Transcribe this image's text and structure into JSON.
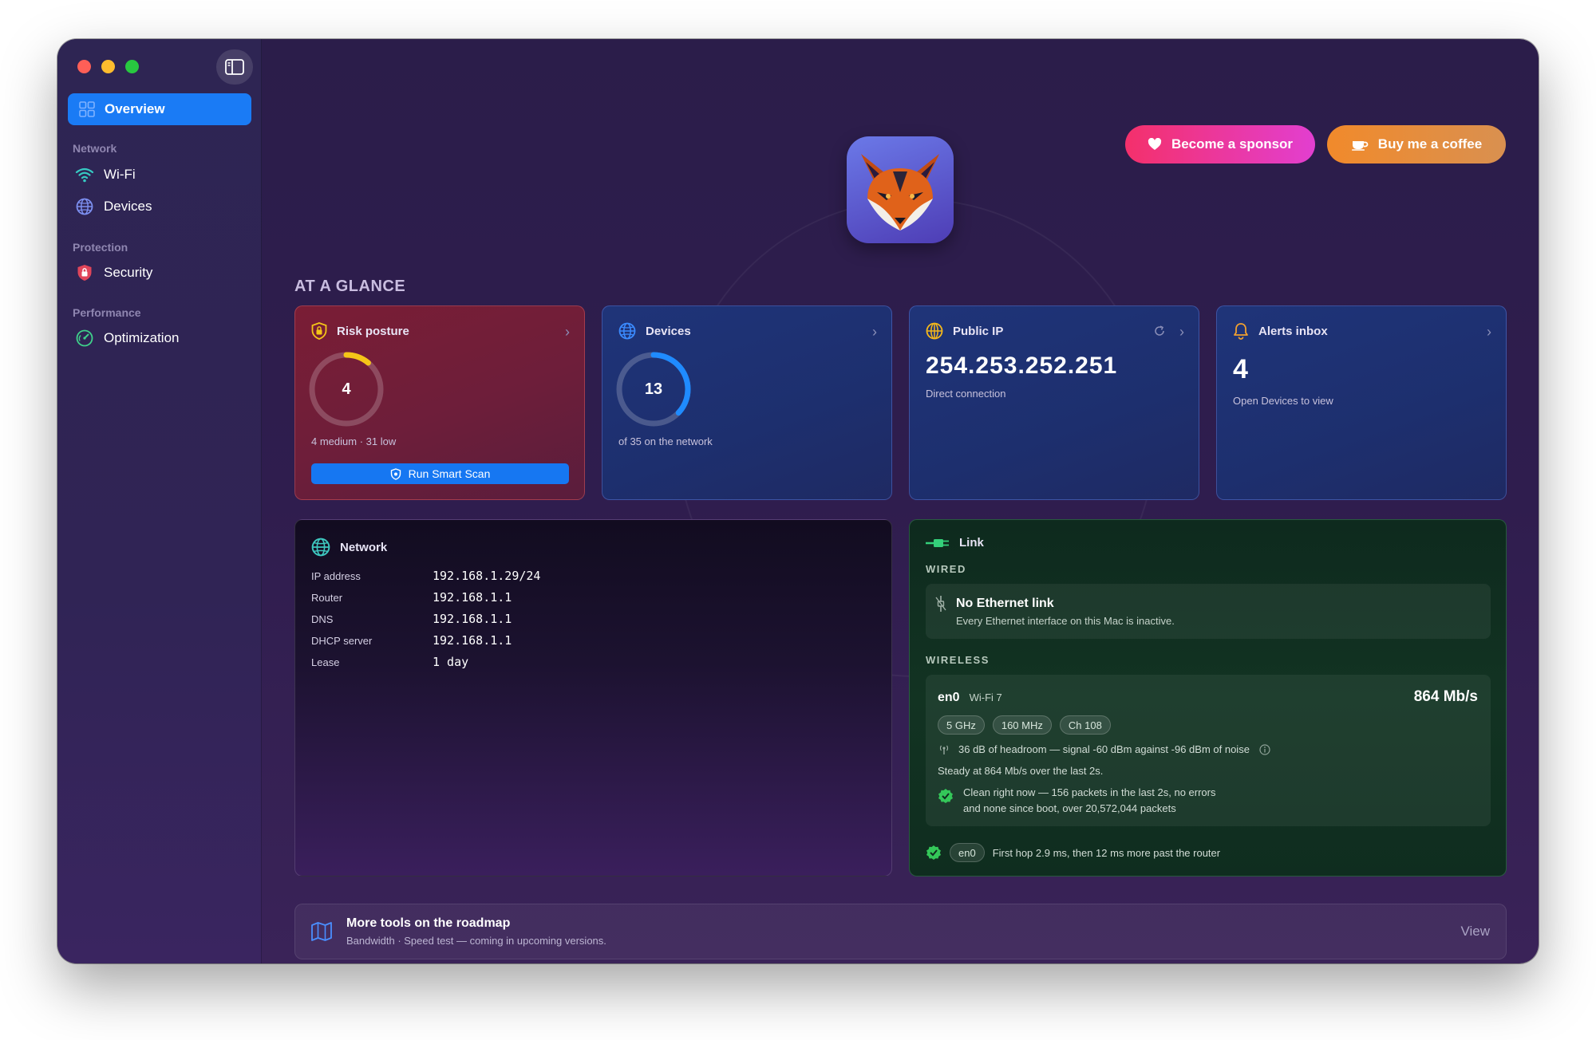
{
  "sidebar": {
    "active": {
      "label": "Overview",
      "icon": "grid-icon"
    },
    "sections": [
      {
        "title": "Network",
        "items": [
          {
            "label": "Wi-Fi",
            "icon": "wifi-icon"
          },
          {
            "label": "Devices",
            "icon": "globe-icon"
          }
        ]
      },
      {
        "title": "Protection",
        "items": [
          {
            "label": "Security",
            "icon": "shield-icon"
          }
        ]
      },
      {
        "title": "Performance",
        "items": [
          {
            "label": "Optimization",
            "icon": "gauge-icon"
          }
        ]
      }
    ]
  },
  "header": {
    "sponsor_label": "Become a sponsor",
    "coffee_label": "Buy me a coffee"
  },
  "glance": {
    "title": "AT A GLANCE",
    "risk": {
      "title": "Risk posture",
      "value": "4",
      "sub": "4 medium · 31 low",
      "scan_label": "Run Smart Scan",
      "ring_fraction": 0.11
    },
    "devices": {
      "title": "Devices",
      "value": "13",
      "sub": "of 35 on the network",
      "ring_fraction": 0.37
    },
    "ip": {
      "title": "Public IP",
      "value": "254.253.252.251",
      "sub": "Direct connection"
    },
    "alerts": {
      "title": "Alerts inbox",
      "value": "4",
      "sub": "Open Devices to view"
    }
  },
  "network": {
    "title": "Network",
    "rows": [
      {
        "key": "IP address",
        "value": "192.168.1.29/24"
      },
      {
        "key": "Router",
        "value": "192.168.1.1"
      },
      {
        "key": "DNS",
        "value": "192.168.1.1"
      },
      {
        "key": "DHCP server",
        "value": "192.168.1.1"
      },
      {
        "key": "Lease",
        "value": "1 day"
      }
    ]
  },
  "link": {
    "title": "Link",
    "wired_label": "WIRED",
    "eth_title": "No Ethernet link",
    "eth_sub": "Every Ethernet interface on this Mac is inactive.",
    "wireless_label": "WIRELESS",
    "iface": "en0",
    "standard": "Wi-Fi 7",
    "rate": "864 Mb/s",
    "tags": [
      "5 GHz",
      "160 MHz",
      "Ch 108"
    ],
    "signal": "36 dB of headroom — signal -60 dBm against -96 dBm of noise",
    "steady": "Steady at 864 Mb/s over the last 2s.",
    "clean_line1": "Clean right now — 156 packets in the last 2s, no errors",
    "clean_line2": "and none since boot, over 20,572,044 packets",
    "hop_iface": "en0",
    "hop_text": "First hop 2.9 ms, then 12 ms more past the router"
  },
  "roadmap": {
    "title": "More tools on the roadmap",
    "sub": "Bandwidth · Speed test — coming in upcoming versions.",
    "view_label": "View"
  },
  "colors": {
    "accent": "#1a7bf5",
    "risk_ring": "#f5c518",
    "device_ring": "#1f8bff",
    "ok_green": "#34c759"
  }
}
